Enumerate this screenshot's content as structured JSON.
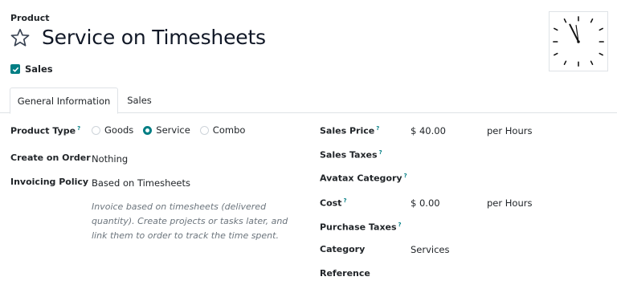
{
  "header": {
    "breadcrumb": "Product",
    "title": "Service on Timesheets"
  },
  "flags": {
    "sales_label": "Sales",
    "sales_checked": true
  },
  "tabs": [
    {
      "label": "General Information",
      "active": true
    },
    {
      "label": "Sales",
      "active": false
    }
  ],
  "left_form": {
    "product_type": {
      "label": "Product Type",
      "help": "?",
      "options": [
        "Goods",
        "Service",
        "Combo"
      ],
      "selected": "Service"
    },
    "create_on_order": {
      "label": "Create on Order",
      "value": "Nothing"
    },
    "invoicing_policy": {
      "label": "Invoicing Policy",
      "value": "Based on Timesheets",
      "hint": "Invoice based on timesheets (delivered quantity). Create projects or tasks later, and link them to order to track the time spent."
    }
  },
  "right_form": {
    "sales_price": {
      "label": "Sales Price",
      "help": "?",
      "value": "$ 40.00",
      "unit": "per Hours"
    },
    "sales_taxes": {
      "label": "Sales Taxes",
      "help": "?"
    },
    "avatax_category": {
      "label": "Avatax Category",
      "help": "?"
    },
    "cost": {
      "label": "Cost",
      "help": "?",
      "value": "$ 0.00",
      "unit": "per Hours"
    },
    "purchase_taxes": {
      "label": "Purchase Taxes",
      "help": "?"
    },
    "category": {
      "label": "Category",
      "value": "Services"
    },
    "reference": {
      "label": "Reference"
    }
  },
  "colors": {
    "accent": "#017e84",
    "text": "#212529",
    "muted": "#6c757d",
    "border": "#dee2e6"
  },
  "icons": {
    "favorite": "star-outline-icon",
    "image": "clock-image"
  }
}
